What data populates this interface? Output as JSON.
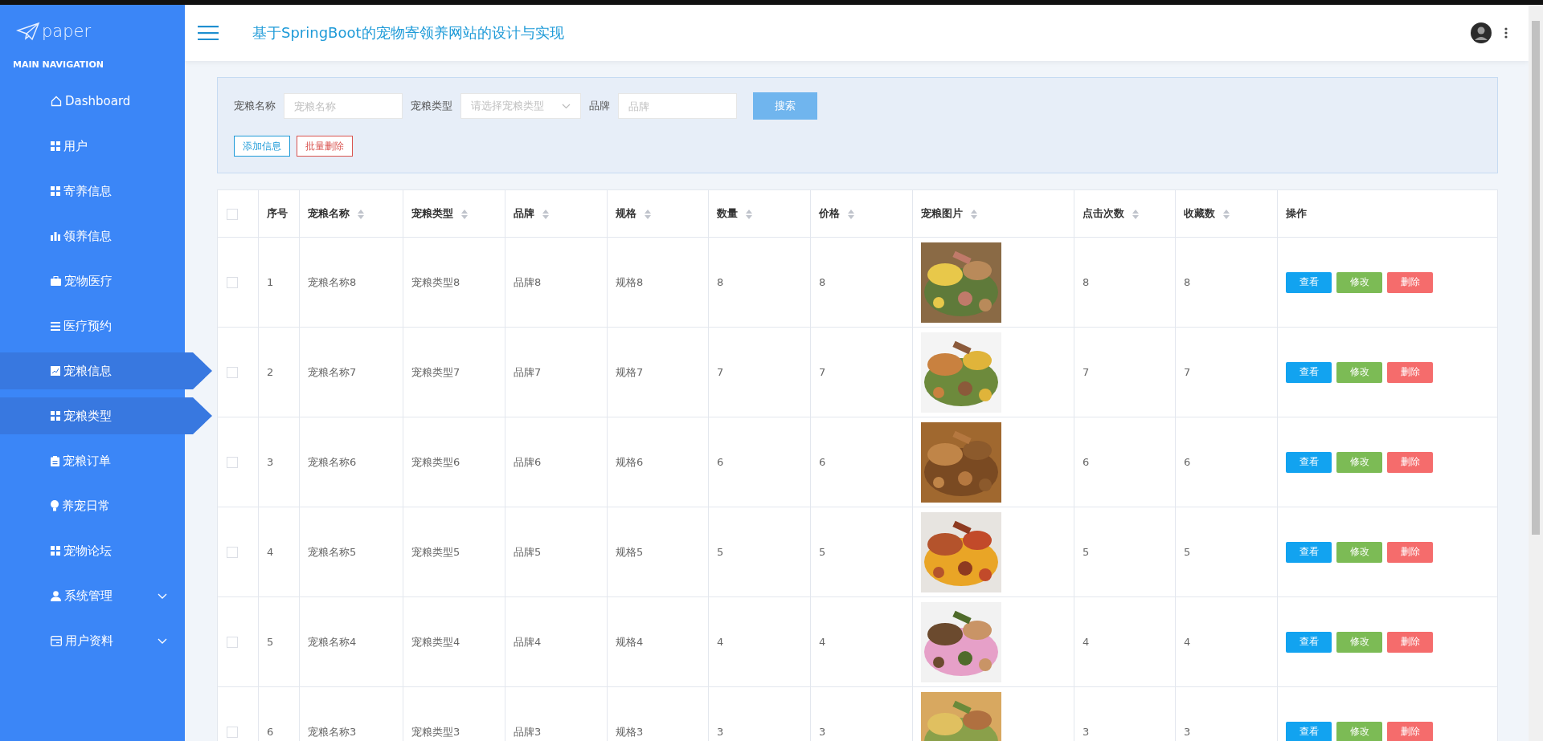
{
  "sidebar": {
    "logo": "paper",
    "section_title": "MAIN NAVIGATION",
    "items": [
      {
        "label": "Dashboard",
        "selected": false,
        "expandable": false
      },
      {
        "label": "用户",
        "selected": false,
        "expandable": false
      },
      {
        "label": "寄养信息",
        "selected": false,
        "expandable": false
      },
      {
        "label": "领养信息",
        "selected": false,
        "expandable": false
      },
      {
        "label": "宠物医疗",
        "selected": false,
        "expandable": false
      },
      {
        "label": "医疗预约",
        "selected": false,
        "expandable": false
      },
      {
        "label": "宠粮信息",
        "selected": true,
        "expandable": false
      },
      {
        "label": "宠粮类型",
        "selected": true,
        "expandable": false
      },
      {
        "label": "宠粮订单",
        "selected": false,
        "expandable": false
      },
      {
        "label": "养宠日常",
        "selected": false,
        "expandable": false
      },
      {
        "label": "宠物论坛",
        "selected": false,
        "expandable": false
      },
      {
        "label": "系统管理",
        "selected": false,
        "expandable": true
      },
      {
        "label": "用户资料",
        "selected": false,
        "expandable": true
      }
    ]
  },
  "header": {
    "title": "基于SpringBoot的宠物寄领养网站的设计与实现"
  },
  "filters": [
    {
      "label": "宠粮名称",
      "kind": "text",
      "placeholder": "宠粮名称"
    },
    {
      "label": "宠粮类型",
      "kind": "select",
      "placeholder": "请选择宠粮类型"
    },
    {
      "label": "品牌",
      "kind": "text",
      "placeholder": "品牌"
    }
  ],
  "search_button": "搜索",
  "actions": [
    {
      "label": "添加信息",
      "kind": "add"
    },
    {
      "label": "批量删除",
      "kind": "delete"
    }
  ],
  "table": {
    "all_checked": false,
    "columns": [
      {
        "label": "序号",
        "sortable": false
      },
      {
        "label": "宠粮名称",
        "sortable": true
      },
      {
        "label": "宠粮类型",
        "sortable": true
      },
      {
        "label": "品牌",
        "sortable": true
      },
      {
        "label": "规格",
        "sortable": true
      },
      {
        "label": "数量",
        "sortable": true
      },
      {
        "label": "价格",
        "sortable": true
      },
      {
        "label": "宠粮图片",
        "sortable": true
      },
      {
        "label": "点击次数",
        "sortable": true
      },
      {
        "label": "收藏数",
        "sortable": true
      },
      {
        "label": "操作",
        "sortable": false
      }
    ],
    "rows": [
      {
        "checked": false,
        "cells": [
          "1",
          "宠粮名称8",
          "宠粮类型8",
          "品牌8",
          "规格8",
          "8",
          "8"
        ],
        "clicks": "8",
        "favorites": "8",
        "buttons": [
          {
            "label": "查看",
            "kind": "view"
          },
          {
            "label": "修改",
            "kind": "edit"
          },
          {
            "label": "删除",
            "kind": "delete"
          }
        ]
      },
      {
        "checked": false,
        "cells": [
          "2",
          "宠粮名称7",
          "宠粮类型7",
          "品牌7",
          "规格7",
          "7",
          "7"
        ],
        "clicks": "7",
        "favorites": "7",
        "buttons": [
          {
            "label": "查看",
            "kind": "view"
          },
          {
            "label": "修改",
            "kind": "edit"
          },
          {
            "label": "删除",
            "kind": "delete"
          }
        ]
      },
      {
        "checked": false,
        "cells": [
          "3",
          "宠粮名称6",
          "宠粮类型6",
          "品牌6",
          "规格6",
          "6",
          "6"
        ],
        "clicks": "6",
        "favorites": "6",
        "buttons": [
          {
            "label": "查看",
            "kind": "view"
          },
          {
            "label": "修改",
            "kind": "edit"
          },
          {
            "label": "删除",
            "kind": "delete"
          }
        ]
      },
      {
        "checked": false,
        "cells": [
          "4",
          "宠粮名称5",
          "宠粮类型5",
          "品牌5",
          "规格5",
          "5",
          "5"
        ],
        "clicks": "5",
        "favorites": "5",
        "buttons": [
          {
            "label": "查看",
            "kind": "view"
          },
          {
            "label": "修改",
            "kind": "edit"
          },
          {
            "label": "删除",
            "kind": "delete"
          }
        ]
      },
      {
        "checked": false,
        "cells": [
          "5",
          "宠粮名称4",
          "宠粮类型4",
          "品牌4",
          "规格4",
          "4",
          "4"
        ],
        "clicks": "4",
        "favorites": "4",
        "buttons": [
          {
            "label": "查看",
            "kind": "view"
          },
          {
            "label": "修改",
            "kind": "edit"
          },
          {
            "label": "删除",
            "kind": "delete"
          }
        ]
      },
      {
        "checked": false,
        "cells": [
          "6",
          "宠粮名称3",
          "宠粮类型3",
          "品牌3",
          "规格3",
          "3",
          "3"
        ],
        "clicks": "3",
        "favorites": "3",
        "buttons": [
          {
            "label": "查看",
            "kind": "view"
          },
          {
            "label": "修改",
            "kind": "edit"
          },
          {
            "label": "删除",
            "kind": "delete"
          }
        ]
      }
    ]
  }
}
